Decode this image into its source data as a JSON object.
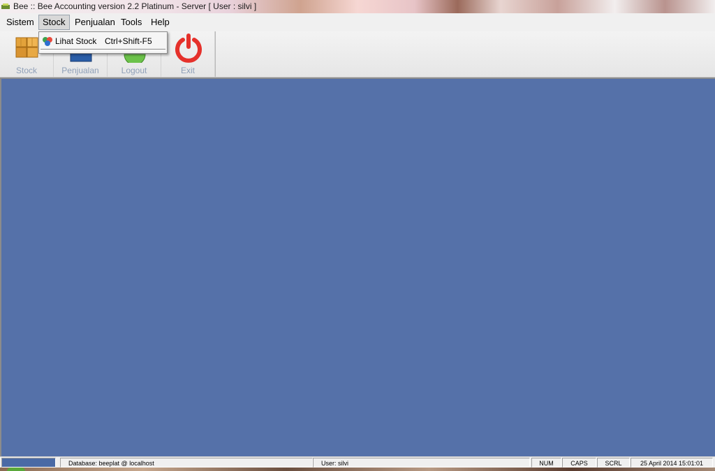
{
  "window": {
    "title": "Bee :: Bee Accounting version 2.2 Platinum - Server  [ User : silvi ]"
  },
  "menu": {
    "items": [
      {
        "label": "Sistem"
      },
      {
        "label": "Stock"
      },
      {
        "label": "Penjualan"
      },
      {
        "label": "Tools"
      },
      {
        "label": "Help"
      }
    ],
    "active_index": 1
  },
  "toolbar": {
    "buttons": [
      {
        "label": "Stock",
        "icon": "boxes-icon"
      },
      {
        "label": "Penjualan",
        "icon": "cash-register-icon"
      },
      {
        "label": "Logout",
        "icon": "logout-icon"
      },
      {
        "label": "Exit",
        "icon": "power-icon"
      }
    ]
  },
  "dropdown": {
    "items": [
      {
        "label": "Lihat Stock",
        "shortcut": "Ctrl+Shift-F5",
        "icon": "stock-view-icon"
      }
    ]
  },
  "statusbar": {
    "database": "Database: beeplat @ localhost",
    "user": "User: silvi",
    "num": "NUM",
    "caps": "CAPS",
    "scrl": "SCRL",
    "datetime": "25 April 2014  15:01:01"
  },
  "colors": {
    "client_background": "#5571a9",
    "toolbar_label": "#8fa0b8",
    "exit_red": "#e5312b"
  }
}
